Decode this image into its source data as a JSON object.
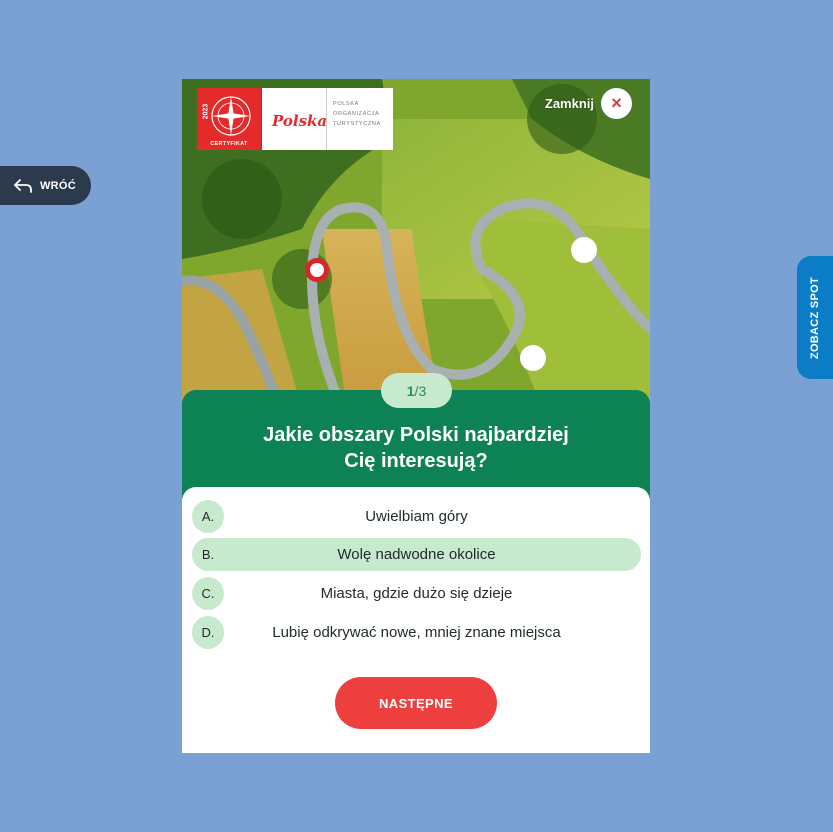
{
  "back": {
    "label": "WRÓĆ",
    "icon": "arrow-back-icon"
  },
  "side_tab": {
    "label": "ZOBACZ SPOT"
  },
  "header": {
    "cert_year": "2023",
    "cert_caption": "CERTYFIKAT",
    "logo_word": "Polska",
    "org_line1": "POLSKA",
    "org_line2": "ORGANIZACJA",
    "org_line3": "TURYSTYCZNA",
    "close_label": "Zamknij",
    "close_icon": "×"
  },
  "quiz": {
    "step_current": "1",
    "step_sep": " / ",
    "step_total": "3",
    "question_line1": "Jakie obszary Polski najbardziej",
    "question_line2": "Cię interesują?",
    "answers": [
      {
        "key": "A.",
        "text": "Uwielbiam góry"
      },
      {
        "key": "B.",
        "text": "Wolę nadwodne okolice"
      },
      {
        "key": "C.",
        "text": "Miasta, gdzie dużo się dzieje"
      },
      {
        "key": "D.",
        "text": "Lubię odkrywać nowe, mniej znane miejsca"
      }
    ],
    "selected_index": 1,
    "next_label": "NASTĘPNE"
  },
  "colors": {
    "background": "#7ba0d4",
    "panel_green": "#0d8254",
    "light_green": "#c7e9cd",
    "accent_red": "#ee3f3f",
    "side_blue": "#0a7dc6"
  }
}
